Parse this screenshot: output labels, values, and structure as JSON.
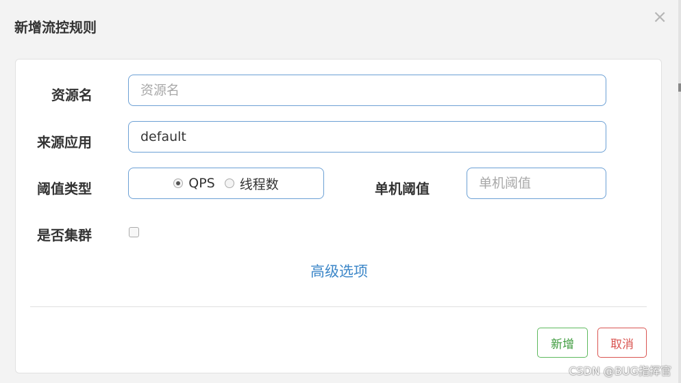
{
  "dialog": {
    "title": "新增流控规则",
    "close_symbol": "×"
  },
  "form": {
    "resource_name": {
      "label": "资源名",
      "placeholder": "资源名",
      "value": ""
    },
    "source_app": {
      "label": "来源应用",
      "value": "default"
    },
    "threshold_type": {
      "label": "阈值类型",
      "options": [
        {
          "label": "QPS",
          "checked": true
        },
        {
          "label": "线程数",
          "checked": false
        }
      ]
    },
    "single_threshold": {
      "label": "单机阈值",
      "placeholder": "单机阈值",
      "value": ""
    },
    "cluster": {
      "label": "是否集群",
      "checked": false
    },
    "advanced_link": "高级选项"
  },
  "footer": {
    "add_label": "新增",
    "cancel_label": "取消"
  },
  "watermark": "CSDN @BUG指挥官",
  "colors": {
    "input_border": "#6a9fd4",
    "link": "#3b86c8",
    "add_button": "#5cb85c",
    "cancel_button": "#d9534f"
  }
}
